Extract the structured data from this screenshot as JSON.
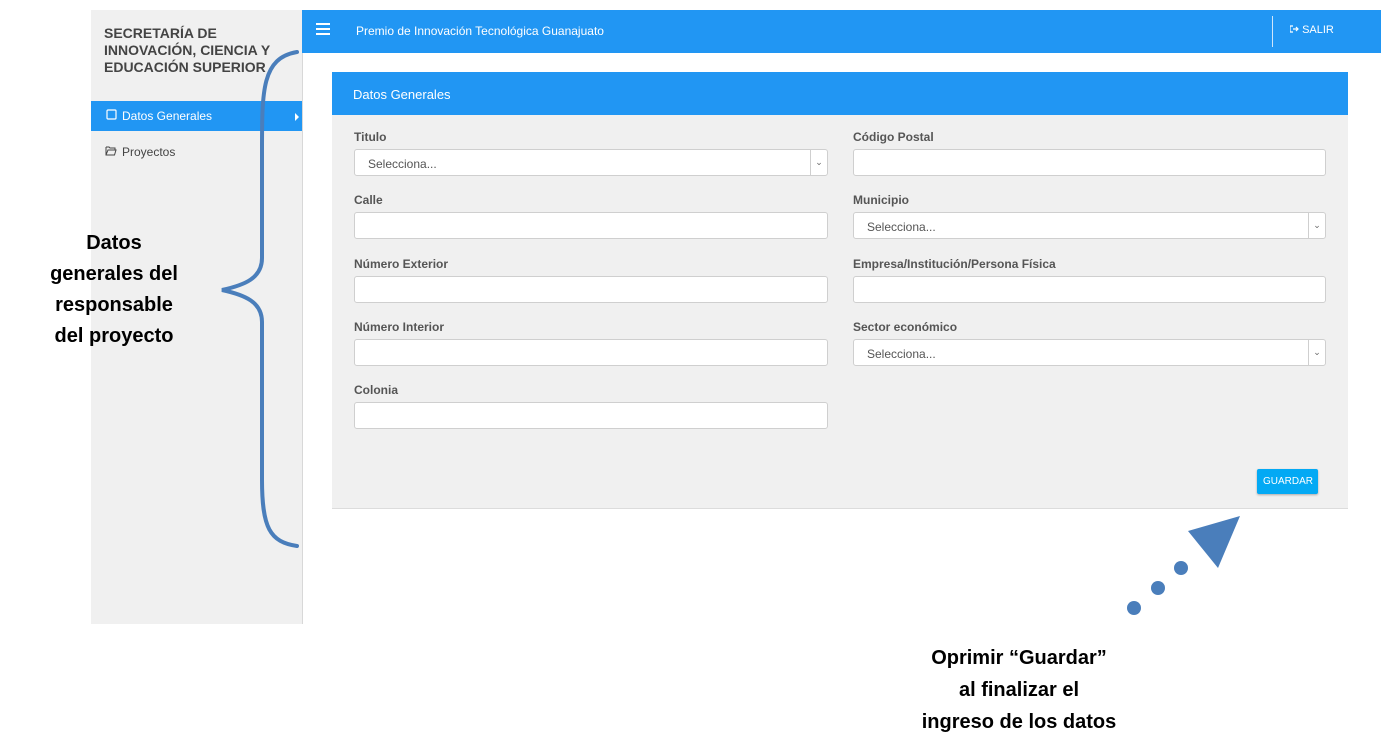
{
  "sidebar": {
    "org_title": "SECRETARÍA DE INNOVACIÓN, CIENCIA Y EDUCACIÓN SUPERIOR",
    "items": [
      {
        "label": "Datos Generales",
        "icon": "document-icon",
        "active": true
      },
      {
        "label": "Proyectos",
        "icon": "folder-open-icon",
        "active": false
      }
    ]
  },
  "header": {
    "app_title": "Premio de Innovación Tecnológica Guanajuato",
    "logout_label": "SALIR",
    "logout_icon": "sign-out-icon",
    "color": "#2196f3"
  },
  "form": {
    "title": "Datos Generales",
    "fields": {
      "titulo": {
        "label": "Titulo",
        "value": "Selecciona..."
      },
      "calle": {
        "label": "Calle",
        "value": ""
      },
      "numero_exterior": {
        "label": "Número Exterior",
        "value": ""
      },
      "numero_interior": {
        "label": "Número Interior",
        "value": ""
      },
      "colonia": {
        "label": "Colonia",
        "value": ""
      },
      "codigo_postal": {
        "label": "Código Postal",
        "value": ""
      },
      "municipio": {
        "label": "Municipio",
        "value": "Selecciona..."
      },
      "empresa": {
        "label": "Empresa/Institución/Persona Física",
        "value": ""
      },
      "sector": {
        "label": "Sector económico",
        "value": "Selecciona..."
      }
    },
    "save_label": "GUARDAR",
    "button_color": "#03a9f4"
  },
  "annotations": {
    "left_lines": [
      "Datos",
      "generales del",
      "responsable",
      "del proyecto"
    ],
    "bottom_lines": [
      "Oprimir “Guardar”",
      "al finalizar el",
      "ingreso de los datos"
    ],
    "color": "#4a7ebb"
  }
}
